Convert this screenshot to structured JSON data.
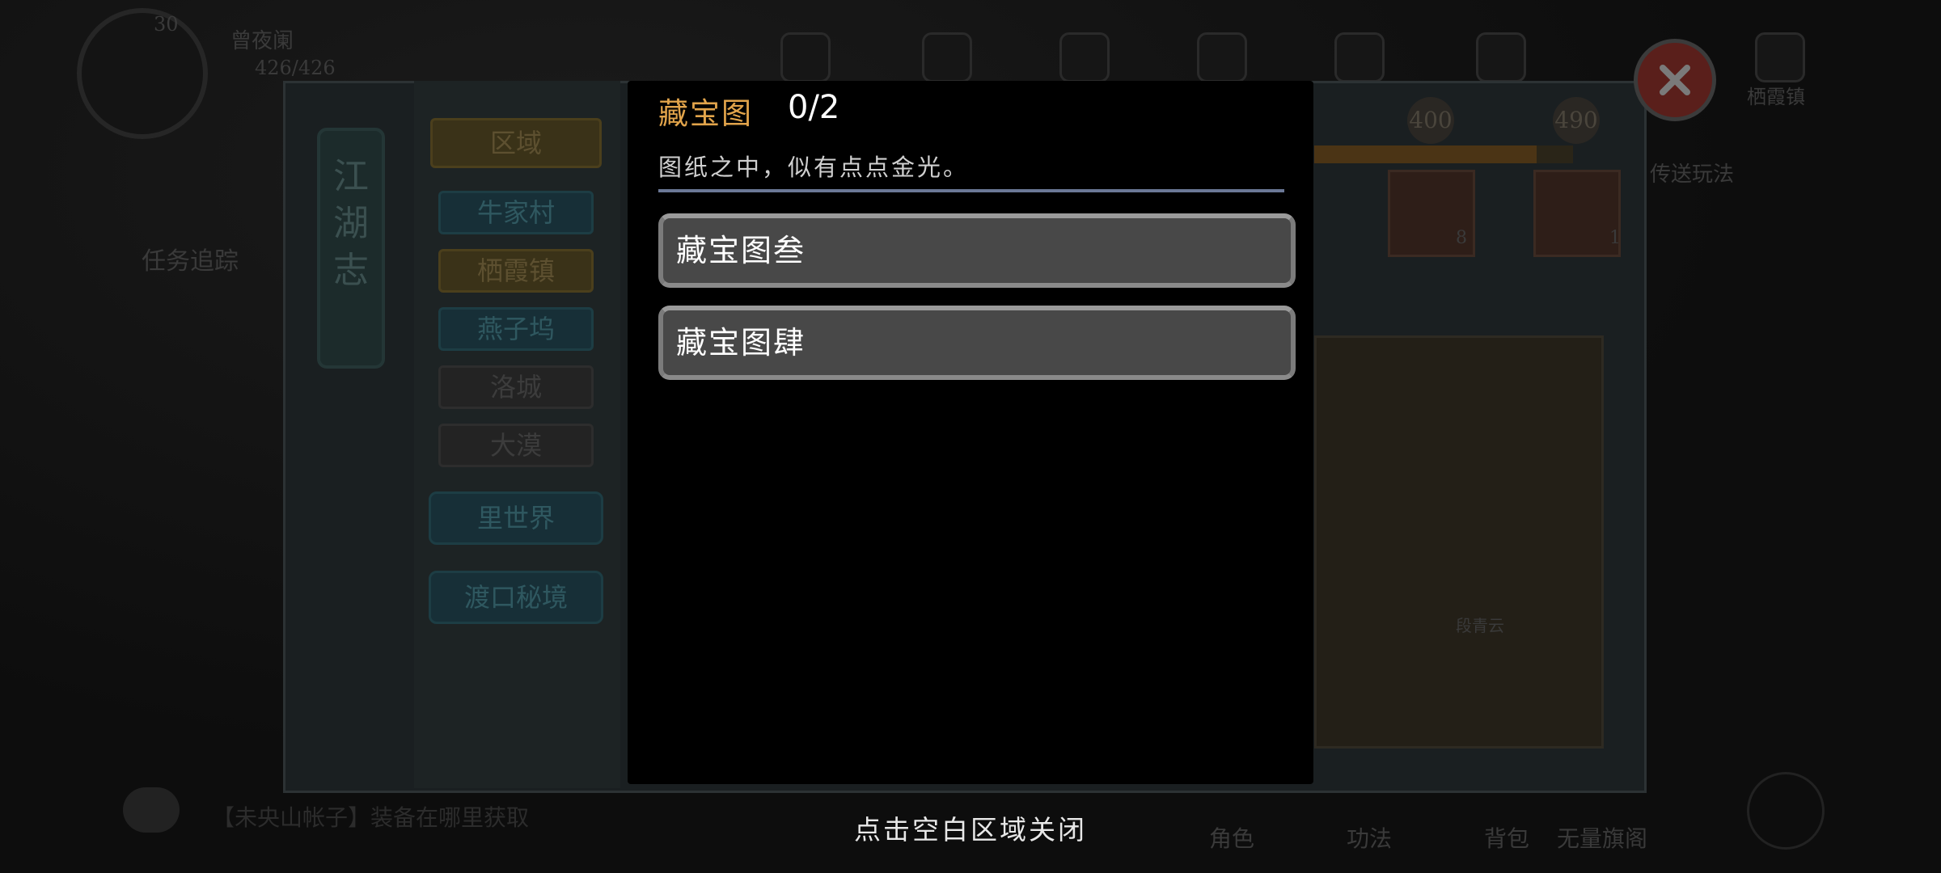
{
  "modal": {
    "title": "藏宝图",
    "count": "0/2",
    "description": "图纸之中，似有点点金光。",
    "items": [
      {
        "label": "藏宝图叁"
      },
      {
        "label": "藏宝图肆"
      }
    ]
  },
  "close_hint": "点击空白区域关闭",
  "background": {
    "player": {
      "level": "30",
      "name": "曾夜阑",
      "hp": "426/426"
    },
    "panel_title": "江湖志",
    "region_header": "区域",
    "regions": [
      "牛家村",
      "栖霞镇",
      "燕子坞",
      "洛城",
      "大漠"
    ],
    "special_buttons": [
      "里世界",
      "渡口秘境"
    ],
    "task_header": "任务追踪",
    "chat_text": "【未央山帐子】装备在哪里获取",
    "progress_values": [
      "400",
      "490"
    ],
    "progress_fraction": 0.86,
    "gem_counts": [
      "8",
      "1"
    ],
    "map_npc_name": "段青云",
    "right_label": "栖霞镇",
    "right_tab": "传送玩法",
    "bottom_tabs": [
      "角色",
      "功法",
      "背包",
      "无量旗阁"
    ],
    "colors": {
      "accent_gold": "#e2a44b",
      "divider": "#6b7896",
      "close_red": "#5a1f1b"
    }
  }
}
